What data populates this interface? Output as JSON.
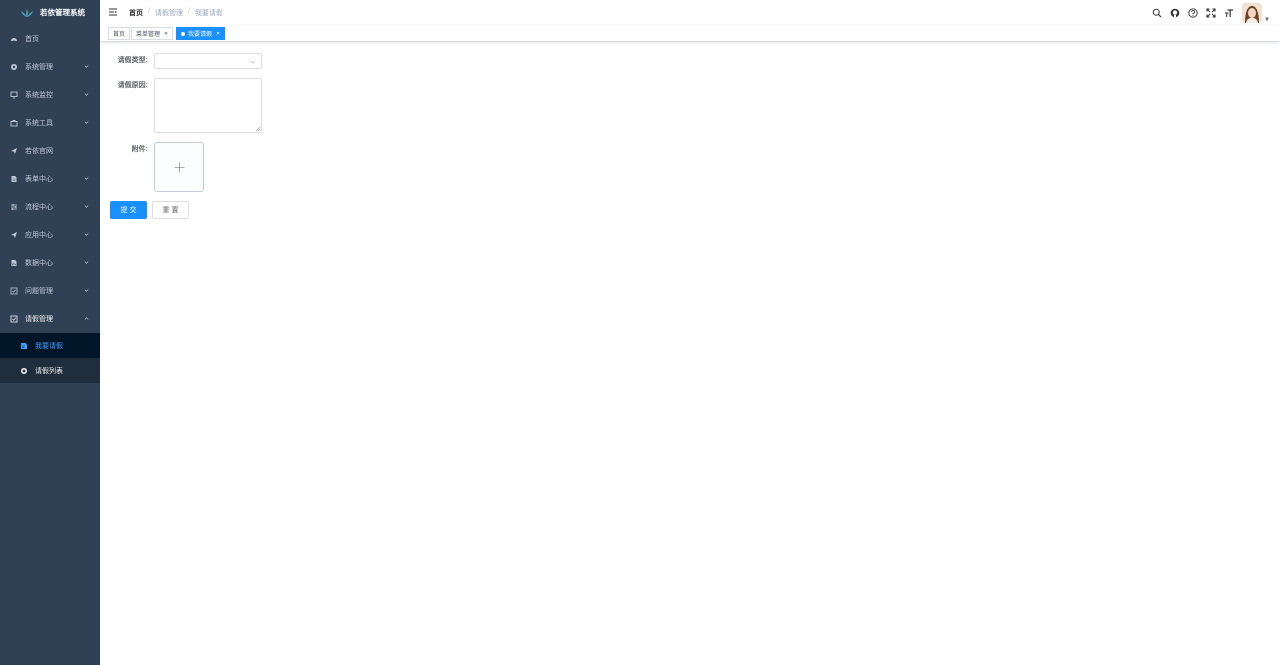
{
  "app": {
    "title": "若依管理系统"
  },
  "sidebar": {
    "items": [
      {
        "label": "首页",
        "icon": "dashboard-icon",
        "has_children": false
      },
      {
        "label": "系统管理",
        "icon": "gear-icon",
        "has_children": true
      },
      {
        "label": "系统监控",
        "icon": "monitor-icon",
        "has_children": true
      },
      {
        "label": "系统工具",
        "icon": "toolbox-icon",
        "has_children": true
      },
      {
        "label": "若依官网",
        "icon": "paper-plane-icon",
        "has_children": false
      },
      {
        "label": "表单中心",
        "icon": "form-icon",
        "has_children": true
      },
      {
        "label": "流程中心",
        "icon": "flow-icon",
        "has_children": true
      },
      {
        "label": "应用中心",
        "icon": "paper-plane-icon",
        "has_children": true
      },
      {
        "label": "数据中心",
        "icon": "data-icon",
        "has_children": true
      },
      {
        "label": "问题管理",
        "icon": "checkbox-icon",
        "has_children": true
      },
      {
        "label": "请假管理",
        "icon": "checkbox-icon",
        "has_children": true,
        "open": true
      }
    ],
    "submenu": [
      {
        "label": "我要请假",
        "icon": "edit-doc-icon",
        "active": true
      },
      {
        "label": "请假列表",
        "icon": "gear-icon",
        "active": false
      }
    ]
  },
  "navbar": {
    "breadcrumb": [
      "首页",
      "请假管理",
      "我要请假"
    ],
    "icons": [
      "search-icon",
      "github-icon",
      "question-icon",
      "fullscreen-icon",
      "font-size-icon"
    ]
  },
  "tags": [
    {
      "label": "首页",
      "closable": false,
      "active": false
    },
    {
      "label": "菜单管理",
      "closable": true,
      "active": false
    },
    {
      "label": "我要请假",
      "closable": true,
      "active": true
    }
  ],
  "form": {
    "type_label": "请假类型:",
    "type_value": "",
    "reason_label": "请假原因:",
    "reason_value": "",
    "attachment_label": "附件:",
    "submit_label": "提 交",
    "reset_label": "重 置"
  },
  "colors": {
    "sidebar_bg": "#304156",
    "sidebar_sub_bg": "#1f2d3d",
    "active_item_bg": "#001528",
    "accent": "#1890ff"
  }
}
